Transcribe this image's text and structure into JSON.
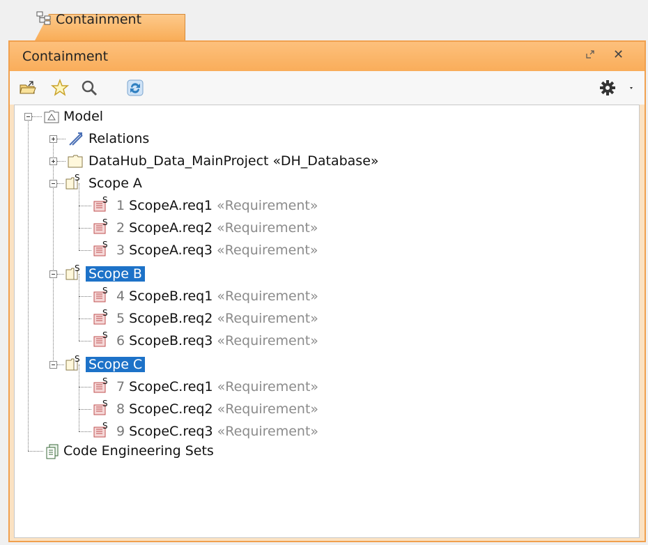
{
  "tab": {
    "label": "Containment"
  },
  "panel": {
    "title": "Containment"
  },
  "tree": {
    "model": "Model",
    "relations": "Relations",
    "datahub": "DataHub_Data_MainProject «DH_Database»",
    "scopeA": "Scope A",
    "scopeB": "Scope B",
    "scopeC": "Scope C",
    "req_stereotype": "«Requirement»",
    "reqs": [
      {
        "num": "1",
        "name": "ScopeA.req1"
      },
      {
        "num": "2",
        "name": "ScopeA.req2"
      },
      {
        "num": "3",
        "name": "ScopeA.req3"
      },
      {
        "num": "4",
        "name": "ScopeB.req1"
      },
      {
        "num": "5",
        "name": "ScopeB.req2"
      },
      {
        "num": "6",
        "name": "ScopeB.req3"
      },
      {
        "num": "7",
        "name": "ScopeC.req1"
      },
      {
        "num": "8",
        "name": "ScopeC.req2"
      },
      {
        "num": "9",
        "name": "ScopeC.req3"
      }
    ],
    "code": "Code Engineering Sets"
  },
  "colors": {
    "accent": "#f9ad5a",
    "selection": "#1d72c8"
  }
}
